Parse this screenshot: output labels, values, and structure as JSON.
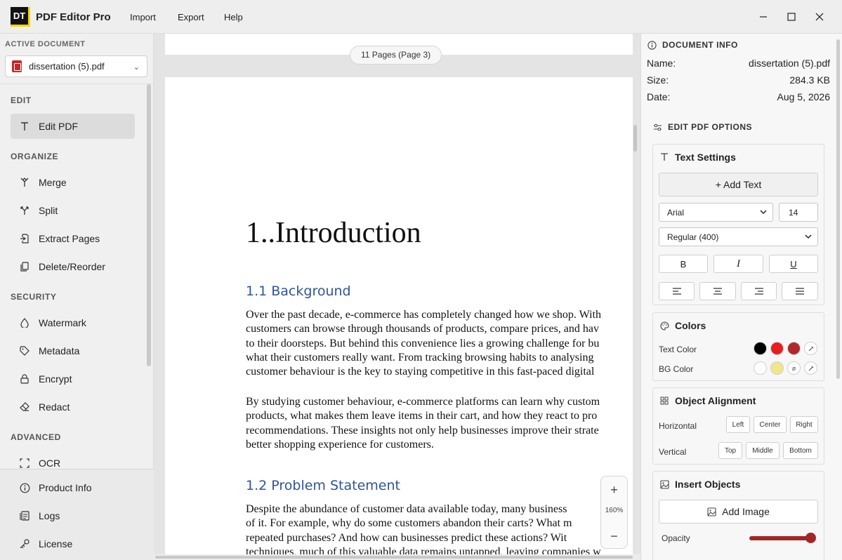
{
  "app": {
    "logo": "DT",
    "title": "PDF Editor Pro"
  },
  "menu": [
    "Import",
    "Export",
    "Help"
  ],
  "window_controls": {
    "minimize": "—",
    "maximize": "☐",
    "close": "✕"
  },
  "sidebar": {
    "active_doc_label": "ACTIVE DOCUMENT",
    "active_doc": "dissertation (5).pdf",
    "sections": [
      {
        "label": "EDIT",
        "items": [
          {
            "label": "Edit PDF",
            "icon": "text-icon",
            "active": true
          }
        ]
      },
      {
        "label": "ORGANIZE",
        "items": [
          {
            "label": "Merge",
            "icon": "merge-icon"
          },
          {
            "label": "Split",
            "icon": "split-icon"
          },
          {
            "label": "Extract Pages",
            "icon": "extract-icon"
          },
          {
            "label": "Delete/Reorder",
            "icon": "copy-icon"
          }
        ]
      },
      {
        "label": "SECURITY",
        "items": [
          {
            "label": "Watermark",
            "icon": "droplet-icon"
          },
          {
            "label": "Metadata",
            "icon": "tag-icon"
          },
          {
            "label": "Encrypt",
            "icon": "lock-icon"
          },
          {
            "label": "Redact",
            "icon": "eraser-icon"
          }
        ]
      },
      {
        "label": "ADVANCED",
        "items": [
          {
            "label": "OCR",
            "icon": "scan-icon"
          }
        ]
      }
    ],
    "bottom_items": [
      {
        "label": "Product Info",
        "icon": "info-icon"
      },
      {
        "label": "Logs",
        "icon": "logs-icon"
      },
      {
        "label": "License",
        "icon": "key-icon"
      }
    ]
  },
  "viewer": {
    "page_indicator": "11 Pages (Page 3)",
    "zoom": "160%",
    "zoom_in": "+",
    "zoom_out": "−",
    "heading1": "1..Introduction",
    "heading2a": "1.1 Background",
    "para1": [
      "Over the past decade, e-commerce has completely changed how we shop. With",
      "customers can browse through thousands of products, compare prices, and hav",
      "to their doorsteps. But behind this convenience lies a growing challenge for bu",
      "what their customers really want. From tracking browsing habits to analysing",
      "customer behaviour is the key to staying competitive in this fast-paced digital"
    ],
    "para2": [
      "By studying customer behaviour, e-commerce platforms can learn why custom",
      "products, what makes them leave items in their cart, and how they react to pro",
      "recommendations. These insights not only help businesses improve their strate",
      "better shopping experience for customers."
    ],
    "heading2b": "1.2 Problem Statement",
    "para3": [
      "Despite the abundance of customer data available today, many business",
      "of it. For example, why do some customers abandon their carts? What m",
      "repeated purchases? And how can businesses predict these actions? Wit",
      "techniques, much of this valuable data remains untapped, leaving companies w"
    ]
  },
  "doc_info": {
    "header": "DOCUMENT INFO",
    "rows": [
      {
        "label": "Name:",
        "value": "dissertation (5).pdf"
      },
      {
        "label": "Size:",
        "value": "284.3 KB"
      },
      {
        "label": "Date:",
        "value": "Aug 5, 2026"
      }
    ]
  },
  "edit_options": {
    "header": "EDIT PDF OPTIONS",
    "text_settings": {
      "title": "Text Settings",
      "add_text": "+ Add Text",
      "font": "Arial",
      "size": "14",
      "weight": "Regular (400)",
      "bold": "B",
      "italic": "I",
      "underline": "U"
    },
    "colors": {
      "title": "Colors",
      "text_color_label": "Text Color",
      "bg_color_label": "BG Color",
      "text_swatches": [
        "#000000",
        "#e61e1e",
        "#b0282a"
      ],
      "bg_swatches": [
        "#ffffff",
        "#f0e68c"
      ],
      "none_symbol": "ø"
    },
    "alignment": {
      "title": "Object Alignment",
      "horizontal_label": "Horizontal",
      "vertical_label": "Vertical",
      "horizontal": [
        "Left",
        "Center",
        "Right"
      ],
      "vertical": [
        "Top",
        "Middle",
        "Bottom"
      ]
    },
    "insert": {
      "title": "Insert Objects",
      "add_image": "Add Image",
      "opacity_label": "Opacity",
      "opacity": 1.0
    }
  }
}
